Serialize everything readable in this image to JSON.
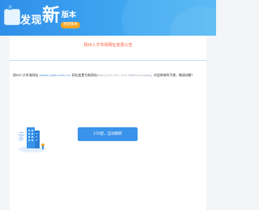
{
  "banner": {
    "gift_tag": "1",
    "found": "发现",
    "new": "新",
    "version": "版本",
    "update_pill": "更新版本"
  },
  "notice": {
    "title": "扬州人才市场网址变更公告"
  },
  "message": {
    "prefix": "扬州人才市场网站",
    "old_url": "(www.yzjob.com.cn)",
    "middle": "网址变更为新网站",
    "new_url": "http://222.191.114.188/rcsc/yzjob",
    ".end": "，对此带来的不便，敬请谅解！",
    "end": "，对此带来的不便，敬请谅解！"
  },
  "button": {
    "label": "15S后，自动跳转"
  },
  "colors": {
    "banner_blue": "#2f8ee9",
    "title_red": "#ff5a36",
    "button_blue": "#3a93ea",
    "link_blue": "#4a8fd6"
  }
}
